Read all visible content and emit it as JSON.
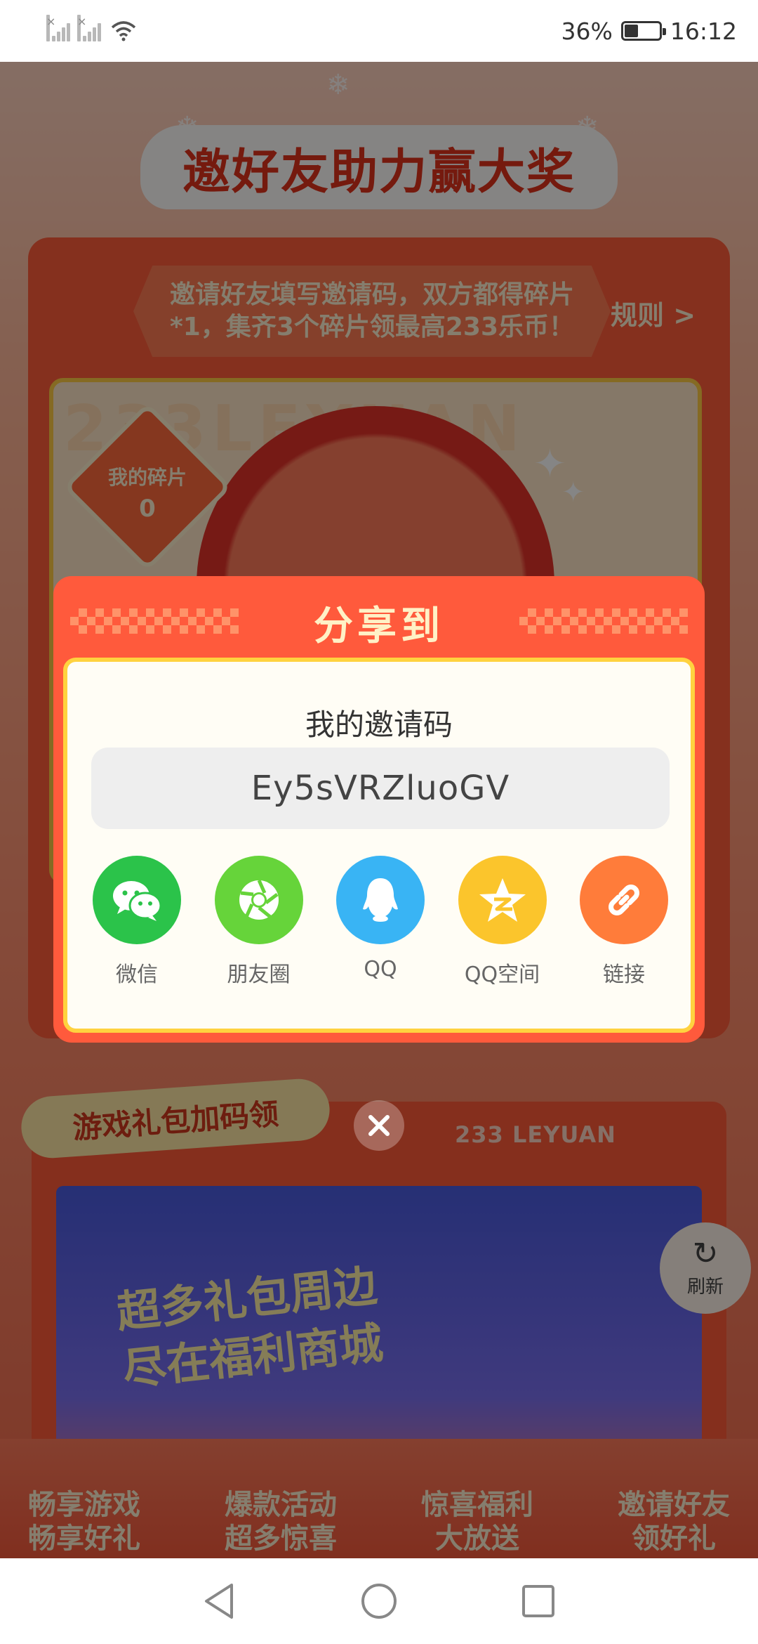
{
  "status_bar": {
    "battery": "36%",
    "time": "16:12",
    "battery_level": 0.36
  },
  "background": {
    "banner_title": "邀好友助力赢大奖",
    "rules_text": "邀请好友填写邀请码，双方都得碎片*1，集齐3个碎片领最高233乐币！",
    "rules_link": "规则 >",
    "watermark": "233LEYUAN",
    "my_fragments_label": "我的碎片",
    "my_fragments_count": "0",
    "gift_section_title": "游戏礼包加码领",
    "leyuan_tag": "233 LEYUAN",
    "promo_title_line1": "超多礼包周边",
    "promo_title_line2": "尽在福利商城",
    "features": [
      {
        "line1": "畅享游戏",
        "line2": "畅享好礼"
      },
      {
        "line1": "爆款活动",
        "line2": "超多惊喜"
      },
      {
        "line1": "惊喜福利",
        "line2": "大放送"
      },
      {
        "line1": "邀请好友",
        "line2": "领好礼"
      }
    ],
    "refresh_label": "刷新"
  },
  "modal": {
    "title": "分享到",
    "invite_label": "我的邀请码",
    "invite_code": "Ey5sVRZluoGV",
    "share_options": [
      {
        "label": "微信",
        "icon": "wechat-icon",
        "color": "#2bc34a"
      },
      {
        "label": "朋友圈",
        "icon": "moments-icon",
        "color": "#66d43a"
      },
      {
        "label": "QQ",
        "icon": "qq-icon",
        "color": "#39b4f4"
      },
      {
        "label": "QQ空间",
        "icon": "qzone-icon",
        "color": "#fbc52c"
      },
      {
        "label": "链接",
        "icon": "link-icon",
        "color": "#ff7c3a"
      }
    ]
  },
  "nav_bar": {
    "back": "back-icon",
    "home": "home-icon",
    "recents": "recents-icon"
  }
}
